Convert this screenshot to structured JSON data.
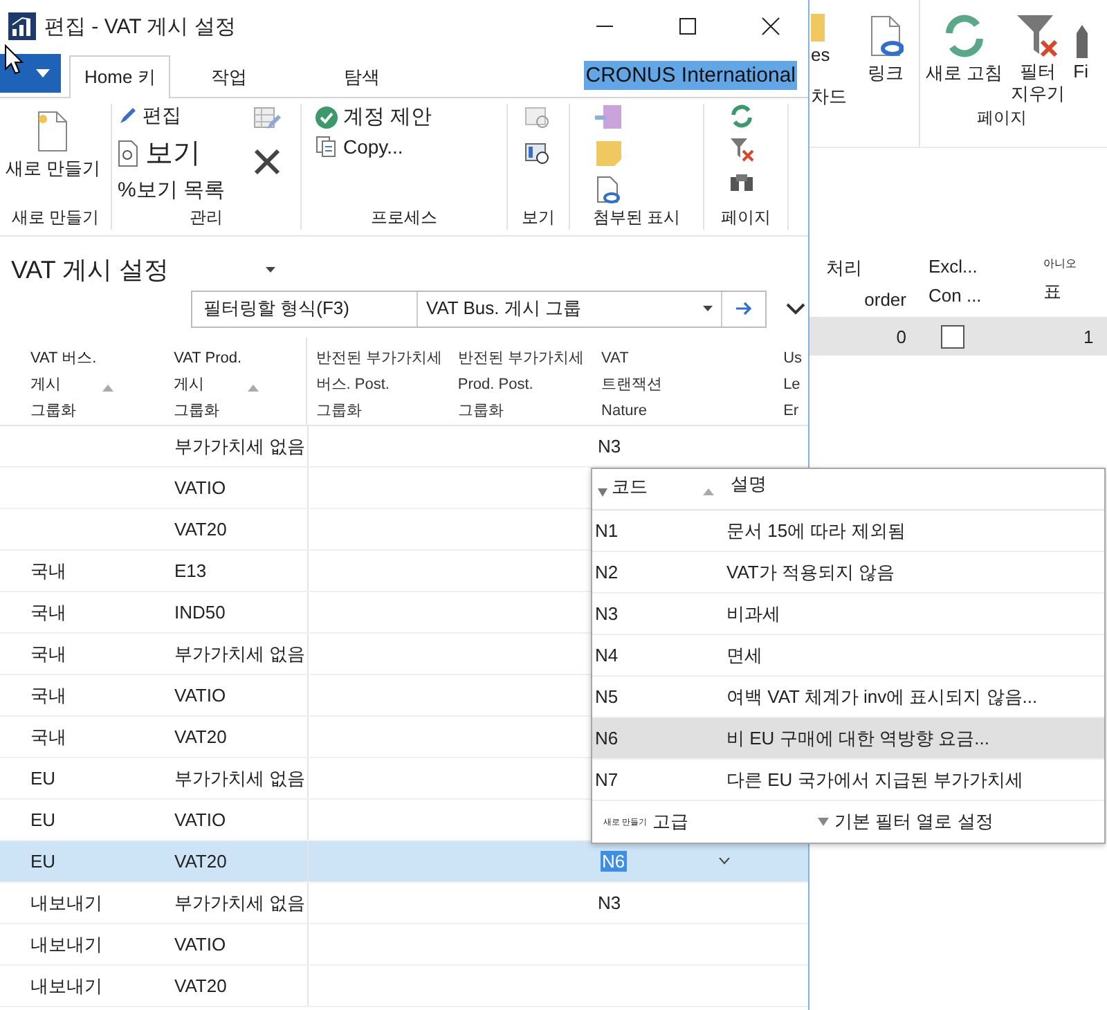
{
  "window": {
    "title": "편집 - VAT 게시 설정"
  },
  "tabs": [
    {
      "label": "Home 키",
      "selected": true
    },
    {
      "label": "작업",
      "selected": false
    },
    {
      "label": "탐색",
      "selected": false
    }
  ],
  "company": "CRONUS International",
  "ribbon": {
    "new": {
      "button": "새로 만들기",
      "group": "새로 만들기"
    },
    "manage": {
      "edit": "편집",
      "view": "보기",
      "view_list": "%보기 목록",
      "group": "관리"
    },
    "process": {
      "suggest": "계정 제안",
      "copy": "Copy...",
      "group": "프로세스"
    },
    "view": {
      "group": "보기"
    },
    "attached": {
      "group": "첨부된 표시"
    },
    "page": {
      "group": "페이지"
    }
  },
  "page_title": "VAT 게시 설정",
  "filter": {
    "label": "필터링할 형식(F3)",
    "field": "VAT Bus. 게시 그룹"
  },
  "table": {
    "columns": [
      {
        "header": "VAT 버스.\n게시\n그룹화",
        "sortable": true
      },
      {
        "header": "VAT Prod.\n게시\n그룹화",
        "sortable": true
      },
      {
        "header": "반전된 부가가치세\n버스. Post.\n그룹화",
        "sortable": false
      },
      {
        "header": "반전된 부가가치세\nProd. Post.\n그룹화",
        "sortable": false
      },
      {
        "header": "VAT\n트랜잭션\nNature",
        "sortable": false
      },
      {
        "header": "Us\nLe\nEr",
        "sortable": false
      }
    ],
    "rows": [
      {
        "prod": "부가가치세 없음",
        "nature": "N3",
        "selected": false
      },
      {
        "prod": "VATIO",
        "selected": false
      },
      {
        "prod": "VAT20",
        "selected": false
      },
      {
        "bus": "국내",
        "prod": "E13",
        "selected": false
      },
      {
        "bus": "국내",
        "prod": "IND50",
        "selected": false
      },
      {
        "bus": "국내",
        "prod": "부가가치세 없음",
        "selected": false
      },
      {
        "bus": "국내",
        "prod": "VATIO",
        "selected": false
      },
      {
        "bus": "국내",
        "prod": "VAT20",
        "selected": false
      },
      {
        "bus": "EU",
        "prod": "부가가치세 없음",
        "selected": false
      },
      {
        "bus": "EU",
        "prod": "VATIO",
        "selected": false
      },
      {
        "bus": "EU",
        "prod": "VAT20",
        "nature": "N6",
        "selected": true
      },
      {
        "bus": "내보내기",
        "prod": "부가가치세 없음",
        "nature": "N3",
        "selected": false
      },
      {
        "bus": "내보내기",
        "prod": "VATIO",
        "selected": false
      },
      {
        "bus": "내보내기",
        "prod": "VAT20",
        "selected": false
      }
    ]
  },
  "lookup": {
    "columns": [
      "코드",
      "설명"
    ],
    "rows": [
      {
        "code": "N1",
        "description": "문서 15에 따라 제외됨",
        "selected": false
      },
      {
        "code": "N2",
        "description": "VAT가 적용되지 않음",
        "selected": false
      },
      {
        "code": "N3",
        "description": "비과세",
        "selected": false
      },
      {
        "code": "N4",
        "description": "면세",
        "selected": false
      },
      {
        "code": "N5",
        "description": "여백 VAT 체계가 inv에 표시되지 않음...",
        "selected": false
      },
      {
        "code": "N6",
        "description": "비 EU 구매에 대한 역방향 요금...",
        "selected": true
      },
      {
        "code": "N7",
        "description": "다른 EU 국가에서 지급된 부가가치세",
        "selected": false
      }
    ],
    "footer": {
      "new": "새로 만들기",
      "advanced": "고급",
      "set_filter": "기본 필터 열로 설정"
    }
  },
  "background_window": {
    "ribbon": {
      "cut_button": "es",
      "link": "링크",
      "cut_group": "차드",
      "refresh": "새로 고침",
      "clear_filter": "필터\n지우기",
      "cut_right": "Fi",
      "page_group": "페이지"
    },
    "columns": [
      {
        "lines": [
          "처리",
          "order"
        ]
      },
      {
        "lines": [
          "Excl...",
          "Con ..."
        ]
      },
      {
        "lines": [
          "아니오",
          "표"
        ]
      }
    ],
    "row": {
      "value": "0",
      "checked": false,
      "value_2": "1",
      "selected": true
    }
  }
}
